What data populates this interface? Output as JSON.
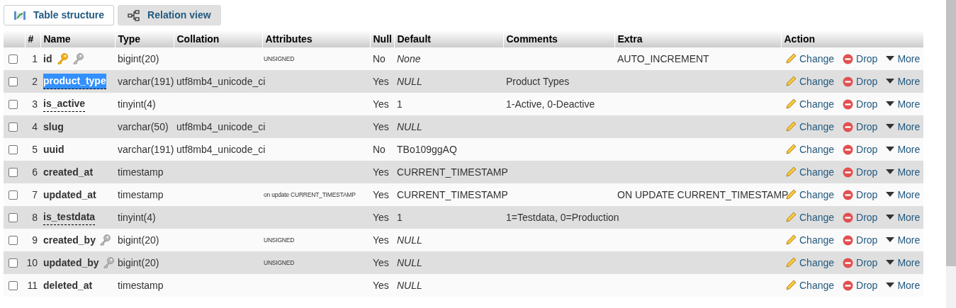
{
  "tabs": [
    {
      "label": "Table structure",
      "selected": true
    },
    {
      "label": "Relation view",
      "selected": false
    }
  ],
  "table": {
    "columns": [
      "#",
      "Name",
      "Type",
      "Collation",
      "Attributes",
      "Null",
      "Default",
      "Comments",
      "Extra",
      "Action"
    ],
    "rows": [
      {
        "checked": false,
        "num": "1",
        "name": "id",
        "primary_key": true,
        "index_key": true,
        "underlined": false,
        "highlighted": false,
        "type": "bigint(20)",
        "attributes": "UNSIGNED",
        "null": "No",
        "default": "None",
        "default_italic": true,
        "extra": "AUTO_INCREMENT",
        "actions": [
          "Change",
          "Drop",
          "More"
        ]
      },
      {
        "checked": false,
        "num": "2",
        "name": "product_type",
        "primary_key": false,
        "index_key": false,
        "underlined": true,
        "highlighted": true,
        "type": "varchar(191)",
        "collation": "utf8mb4_unicode_ci",
        "null": "Yes",
        "default": "NULL",
        "default_italic": true,
        "comments": "Product Types",
        "actions": [
          "Change",
          "Drop",
          "More"
        ]
      },
      {
        "checked": false,
        "num": "3",
        "name": "is_active",
        "primary_key": false,
        "index_key": false,
        "underlined": true,
        "highlighted": false,
        "type": "tinyint(4)",
        "null": "Yes",
        "default": "1",
        "default_italic": false,
        "comments": "1-Active, 0-Deactive",
        "actions": [
          "Change",
          "Drop",
          "More"
        ]
      },
      {
        "checked": false,
        "num": "4",
        "name": "slug",
        "primary_key": false,
        "index_key": false,
        "underlined": false,
        "highlighted": false,
        "type": "varchar(50)",
        "collation": "utf8mb4_unicode_ci",
        "null": "Yes",
        "default": "NULL",
        "default_italic": true,
        "actions": [
          "Change",
          "Drop",
          "More"
        ]
      },
      {
        "checked": false,
        "num": "5",
        "name": "uuid",
        "primary_key": false,
        "index_key": false,
        "underlined": false,
        "highlighted": false,
        "type": "varchar(191)",
        "collation": "utf8mb4_unicode_ci",
        "null": "No",
        "default": "TBo109ggAQ",
        "default_italic": false,
        "actions": [
          "Change",
          "Drop",
          "More"
        ]
      },
      {
        "checked": false,
        "num": "6",
        "name": "created_at",
        "primary_key": false,
        "index_key": false,
        "underlined": false,
        "highlighted": false,
        "type": "timestamp",
        "null": "Yes",
        "default": "CURRENT_TIMESTAMP",
        "default_italic": false,
        "actions": [
          "Change",
          "Drop",
          "More"
        ]
      },
      {
        "checked": false,
        "num": "7",
        "name": "updated_at",
        "primary_key": false,
        "index_key": false,
        "underlined": false,
        "highlighted": false,
        "type": "timestamp",
        "attributes": "on update CURRENT_TIMESTAMP",
        "null": "Yes",
        "default": "CURRENT_TIMESTAMP",
        "default_italic": false,
        "extra": "ON UPDATE CURRENT_TIMESTAMP",
        "actions": [
          "Change",
          "Drop",
          "More"
        ]
      },
      {
        "checked": false,
        "num": "8",
        "name": "is_testdata",
        "primary_key": false,
        "index_key": false,
        "underlined": true,
        "highlighted": false,
        "type": "tinyint(4)",
        "null": "Yes",
        "default": "1",
        "default_italic": false,
        "comments": "1=Testdata, 0=Production",
        "actions": [
          "Change",
          "Drop",
          "More"
        ]
      },
      {
        "checked": false,
        "num": "9",
        "name": "created_by",
        "primary_key": false,
        "index_key": true,
        "underlined": false,
        "highlighted": false,
        "type": "bigint(20)",
        "attributes": "UNSIGNED",
        "null": "Yes",
        "default": "NULL",
        "default_italic": true,
        "actions": [
          "Change",
          "Drop",
          "More"
        ]
      },
      {
        "checked": false,
        "num": "10",
        "name": "updated_by",
        "primary_key": false,
        "index_key": true,
        "underlined": false,
        "highlighted": false,
        "type": "bigint(20)",
        "attributes": "UNSIGNED",
        "null": "Yes",
        "default": "NULL",
        "default_italic": true,
        "actions": [
          "Change",
          "Drop",
          "More"
        ]
      },
      {
        "checked": false,
        "num": "11",
        "name": "deleted_at",
        "primary_key": false,
        "index_key": false,
        "underlined": false,
        "highlighted": false,
        "type": "timestamp",
        "null": "Yes",
        "default": "NULL",
        "default_italic": true,
        "actions": [
          "Change",
          "Drop",
          "More"
        ]
      }
    ]
  }
}
